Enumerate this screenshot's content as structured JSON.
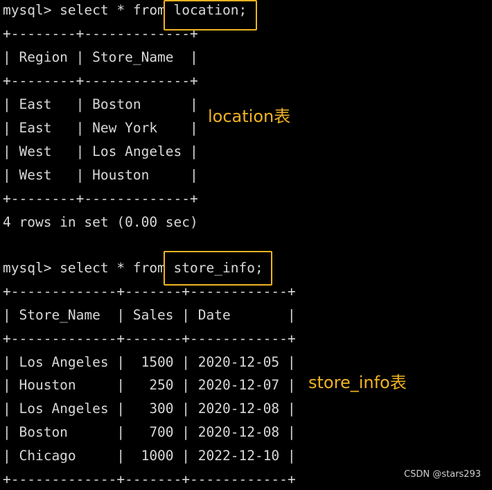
{
  "accent_color": "#f0b323",
  "terminal": {
    "lines": [
      "mysql> select * from location;",
      "+--------+-------------+",
      "| Region | Store_Name  |",
      "+--------+-------------+",
      "| East   | Boston      |",
      "| East   | New York    |",
      "| West   | Los Angeles |",
      "| West   | Houston     |",
      "+--------+-------------+",
      "4 rows in set (0.00 sec)",
      "",
      "mysql> select * from store_info;",
      "+-------------+-------+------------+",
      "| Store_Name  | Sales | Date       |",
      "+-------------+-------+------------+",
      "| Los Angeles |  1500 | 2020-12-05 |",
      "| Houston     |   250 | 2020-12-07 |",
      "| Los Angeles |   300 | 2020-12-08 |",
      "| Boston      |   700 | 2020-12-08 |",
      "| Chicago     |  1000 | 2022-12-10 |",
      "+-------------+-------+------------+"
    ]
  },
  "annotations": {
    "location_label": "location表",
    "store_info_label": "store_info表"
  },
  "watermark": "CSDN @stars293"
}
